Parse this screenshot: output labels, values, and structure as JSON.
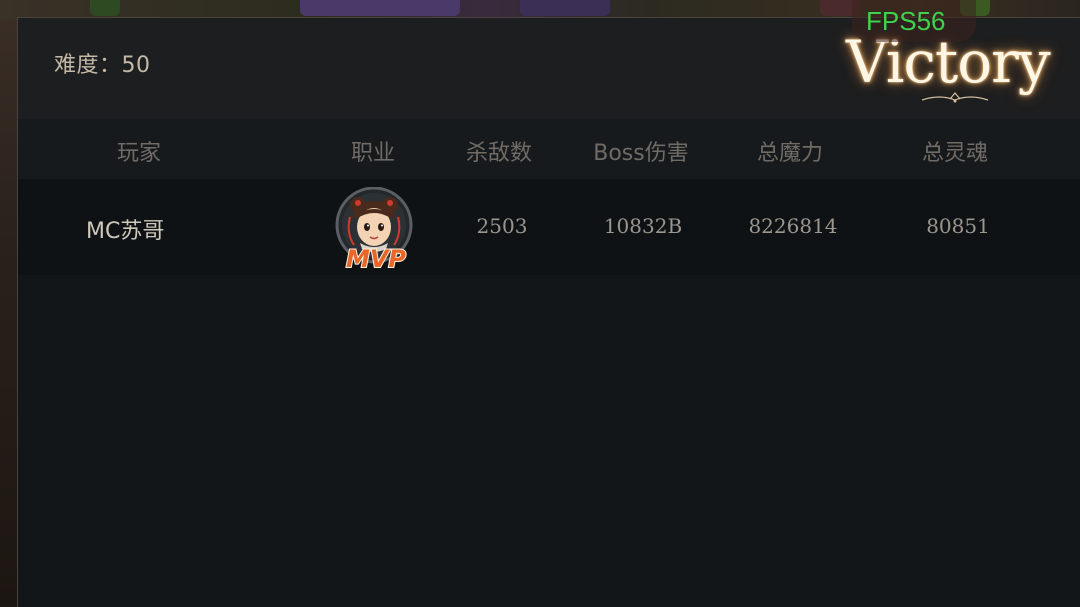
{
  "overlay": {
    "fps_label": "FPS56"
  },
  "banner": {
    "result_text": "Victory"
  },
  "header": {
    "difficulty_label": "难度：50"
  },
  "table": {
    "columns": [
      "玩家",
      "职业",
      "杀敌数",
      "Boss伤害",
      "总魔力",
      "总灵魂"
    ],
    "rows": [
      {
        "player": "MC苏哥",
        "class_icon": "girl-hero-portrait-icon",
        "badge": "MVP",
        "kills": "2503",
        "boss_damage": "10832B",
        "total_mana": "8226814",
        "total_soul": "80851"
      }
    ]
  },
  "colors": {
    "accent_fps": "#3fd24d",
    "badge_mvp": "#e8662a",
    "victory_glow": "#e6b46a"
  }
}
